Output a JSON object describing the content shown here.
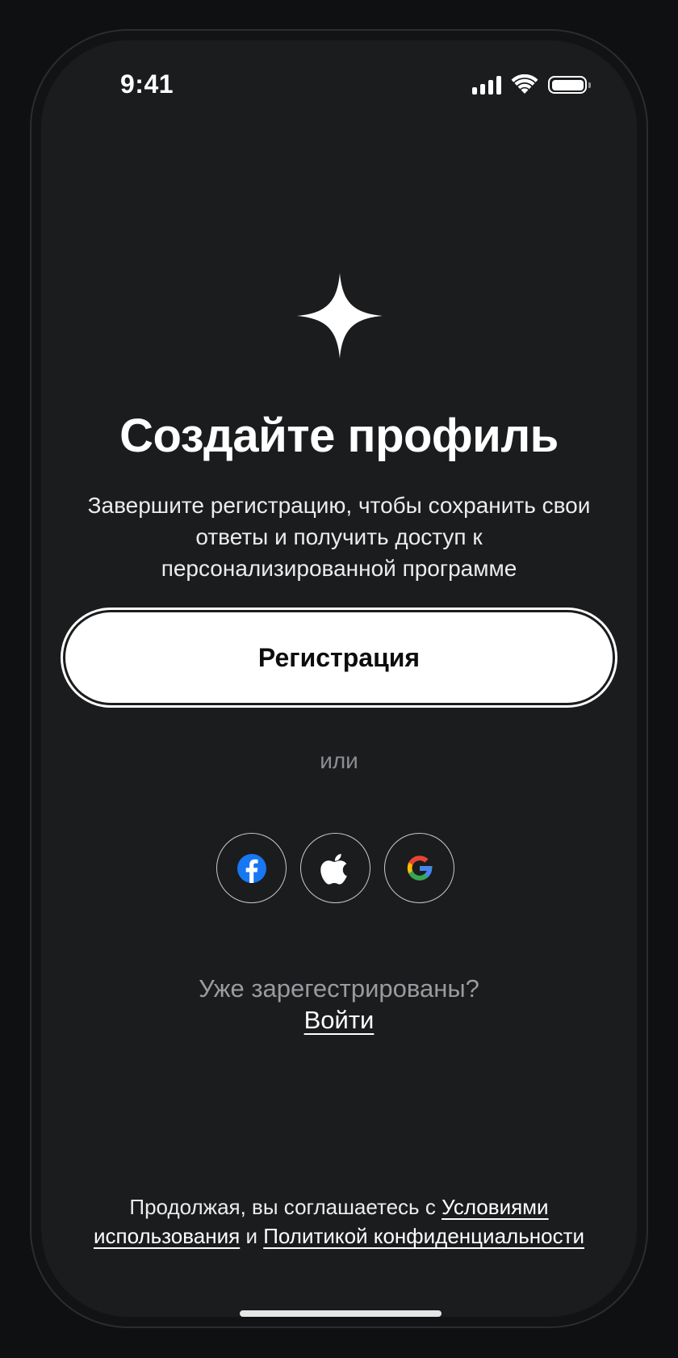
{
  "status_bar": {
    "time": "9:41"
  },
  "main": {
    "title": "Создайте профиль",
    "subtitle_line1": "Завершите регистрацию, чтобы сохранить свои",
    "subtitle_line2": "ответы и получить доступ к",
    "subtitle_line3": "персонализированной программе",
    "register_label": "Регистрация",
    "or_label": "или"
  },
  "social": [
    {
      "icon": "facebook-icon",
      "color": "#1877f2"
    },
    {
      "icon": "apple-icon",
      "color": "#ffffff"
    },
    {
      "icon": "google-icon",
      "color": "#4285f4"
    }
  ],
  "login": {
    "prompt": "Уже зарегестрированы?",
    "link": "Войти"
  },
  "legal": {
    "prefix": "Продолжая, вы соглашаетесь с ",
    "terms": "Условиями использования",
    "middle": " и ",
    "privacy": "Политикой конфиденциальности"
  },
  "colors": {
    "background": "#1b1c1e",
    "button": "#ffffff"
  }
}
